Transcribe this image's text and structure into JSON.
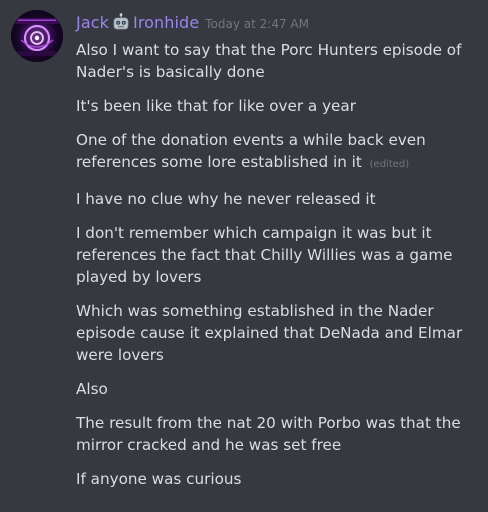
{
  "author": {
    "name_part1": "Jack",
    "name_part2": "Ironhide",
    "name_color": "#9b84ee",
    "mid_icon": "robot-head-icon",
    "timestamp": "Today at 2:47 AM"
  },
  "avatar": {
    "icon": "purple-glow-logo-avatar"
  },
  "messages": [
    {
      "text": "Also I want to say that the Porc Hunters episode of Nader's is basically done",
      "edited": ""
    },
    {
      "text": "It's been like that for like over a year",
      "edited": ""
    },
    {
      "text": "One of the donation events a while back even references some lore established in it",
      "edited": "(edited)"
    },
    {
      "text": "I have no clue why he never released it",
      "edited": ""
    },
    {
      "text": "I don't remember which campaign it was but it references the fact that Chilly Willies was a game played by lovers",
      "edited": ""
    },
    {
      "text": "Which was something established in the Nader episode cause it explained that DeNada and Elmar were lovers",
      "edited": ""
    },
    {
      "text": "Also",
      "edited": ""
    },
    {
      "text": "The result from the nat 20 with Porbo was that the mirror cracked and he was set free",
      "edited": ""
    },
    {
      "text": "If anyone was curious",
      "edited": ""
    }
  ],
  "colors": {
    "background": "#36393f",
    "text": "#dcddde",
    "muted": "#72767d"
  }
}
